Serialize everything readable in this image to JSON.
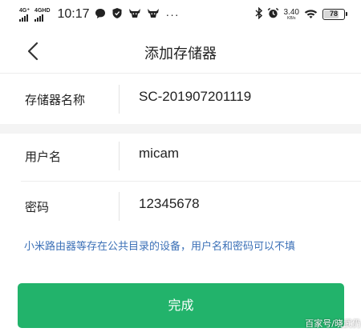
{
  "status_bar": {
    "signal1_label": "4G⁺",
    "signal2_label": "4GHD",
    "time": "10:17",
    "notification_icons": [
      "message-bubble-icon",
      "shield-icon",
      "bull-head-icon",
      "bull-head-icon"
    ],
    "more": "···",
    "bluetooth": "bluetooth-icon",
    "alarm": "alarm-icon",
    "net_speed": "3.40",
    "net_speed_unit": "KB/s",
    "wifi": "wifi-icon",
    "battery_level": "78",
    "battery_fraction": 0.78
  },
  "header": {
    "back_icon": "chevron-left-icon",
    "title": "添加存储器"
  },
  "form": {
    "storage_name": {
      "label": "存储器名称",
      "value": "SC-201907201119"
    },
    "username": {
      "label": "用户名",
      "value": "micam"
    },
    "password": {
      "label": "密码",
      "value": "12345678"
    }
  },
  "hint": "小米路由器等存在公共目录的设备，用户名和密码可以不填",
  "done_button": "完成",
  "watermark": "百家号/晓武仍",
  "colors": {
    "accent_green": "#22b36b",
    "hint_blue": "#3b70b7",
    "divider": "#ececec",
    "section_gap": "#f4f4f4"
  }
}
